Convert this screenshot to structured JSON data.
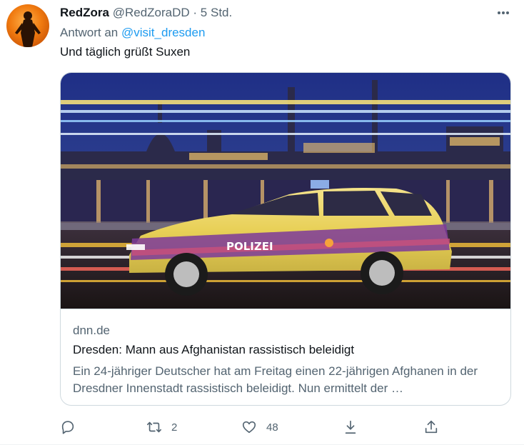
{
  "tweet": {
    "display_name": "RedZora",
    "handle": "@RedZoraDD",
    "separator": "·",
    "time": "5 Std.",
    "reply_prefix": "Antwort an",
    "reply_to": "@visit_dresden",
    "text": "Und täglich grüßt Suxen"
  },
  "card": {
    "image_label": "POLIZEI",
    "domain": "dnn.de",
    "title": "Dresden: Mann aus Afghanistan rassistisch beleidigt",
    "description": "Ein 24-jähriger Deutscher hat am Freitag einen 22-jährigen Afghanen in der Dresdner Innenstadt rassistisch beleidigt. Nun ermittelt der …"
  },
  "actions": {
    "reply_count": "",
    "retweet_count": "2",
    "like_count": "48"
  },
  "icons": {
    "more": "more-horizontal-icon",
    "reply": "reply-icon",
    "retweet": "retweet-icon",
    "like": "heart-icon",
    "share": "share-down-icon",
    "upload": "upload-icon"
  },
  "colors": {
    "link": "#1d9bf0",
    "secondary_text": "#536471",
    "border": "#cfd9de"
  }
}
